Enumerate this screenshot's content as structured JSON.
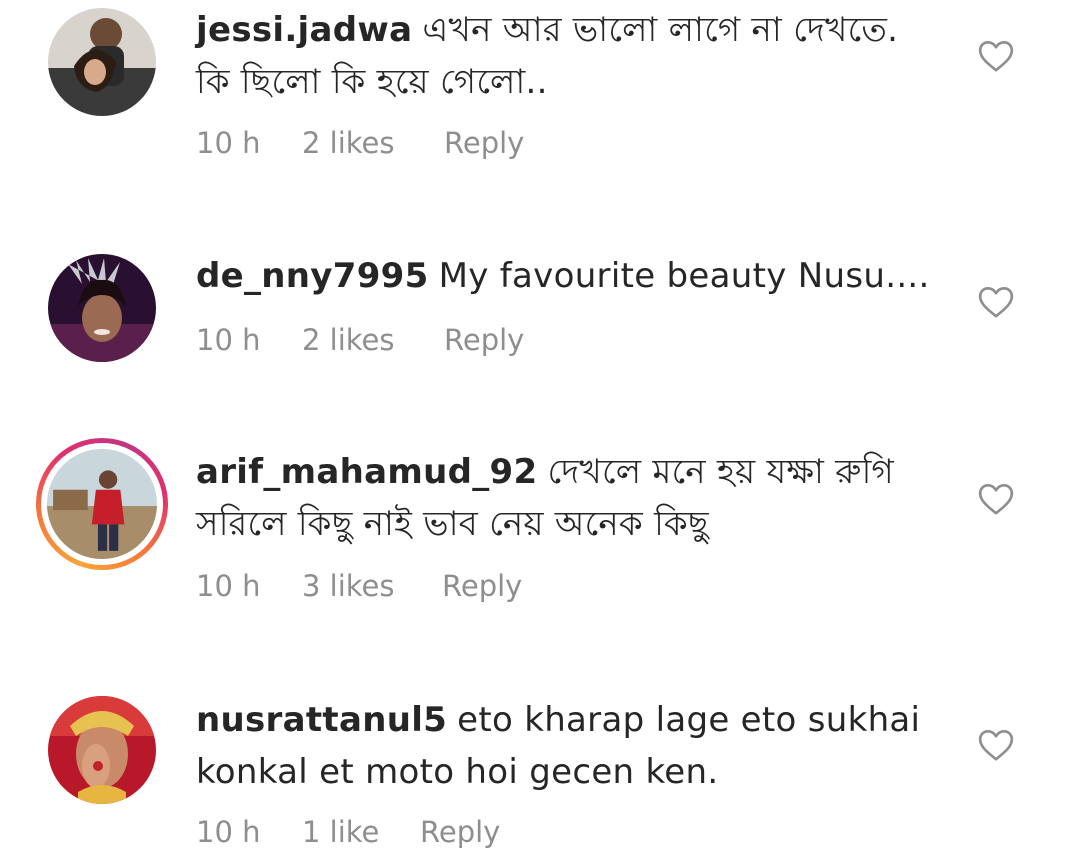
{
  "comments": [
    {
      "username": "jessi.jadwa",
      "text": "এখন আর ভালো লাগে না দেখতে. কি ছিলো কি হয়ে গেলো..",
      "time": "10 h",
      "likes": "2 likes",
      "reply": "Reply"
    },
    {
      "username": "de_nny7995",
      "text": "My favourite beauty Nusu....",
      "time": "10 h",
      "likes": "2 likes",
      "reply": "Reply"
    },
    {
      "username": "arif_mahamud_92",
      "text": "দেখলে মনে হয় যক্ষা রুগি সরিলে কিছু নাই ভাব নেয় অনেক কিছু",
      "time": "10 h",
      "likes": "3 likes",
      "reply": "Reply"
    },
    {
      "username": "nusrattanul5",
      "text": "eto kharap lage eto sukhai konkal et moto hoi gecen ken.",
      "time": "10 h",
      "likes": "1 like",
      "reply": "Reply"
    }
  ],
  "icons": {
    "like": "heart-outline-icon"
  },
  "colors": {
    "text": "#262626",
    "meta": "#8e8e8e",
    "story_ring_start": "#f9a43a",
    "story_ring_end": "#c13584"
  }
}
